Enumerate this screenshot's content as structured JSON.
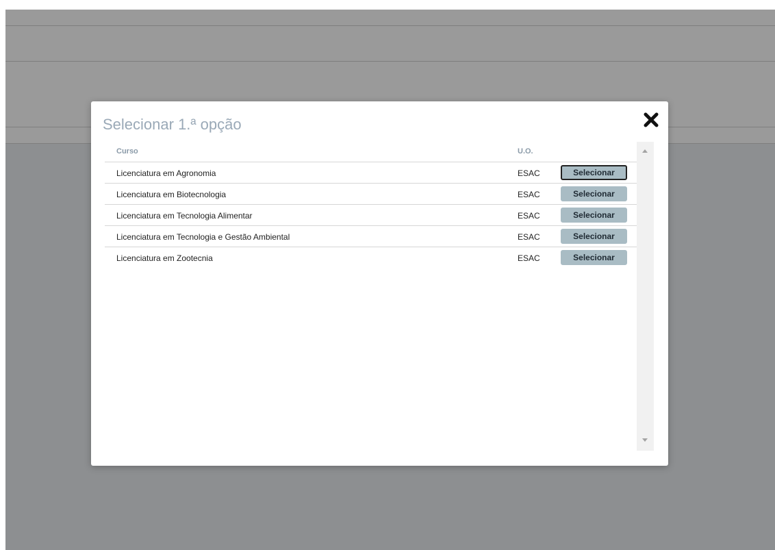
{
  "modal": {
    "title": "Selecionar 1.ª opção",
    "close_icon": "close-x-icon"
  },
  "table": {
    "headers": {
      "course": "Curso",
      "unit": "U.O."
    },
    "rows": [
      {
        "course": "Licenciatura em Agronomia",
        "unit": "ESAC",
        "action": "Selecionar",
        "focused": true
      },
      {
        "course": "Licenciatura em Biotecnologia",
        "unit": "ESAC",
        "action": "Selecionar"
      },
      {
        "course": "Licenciatura em Tecnologia Alimentar",
        "unit": "ESAC",
        "action": "Selecionar"
      },
      {
        "course": "Licenciatura em Tecnologia e Gestão Ambiental",
        "unit": "ESAC",
        "action": "Selecionar"
      },
      {
        "course": "Licenciatura em Zootecnia",
        "unit": "ESAC",
        "action": "Selecionar"
      }
    ]
  },
  "colors": {
    "overlay": "#8d8f91",
    "title": "#9aa9b7",
    "button_bg": "#a9bcc4"
  }
}
